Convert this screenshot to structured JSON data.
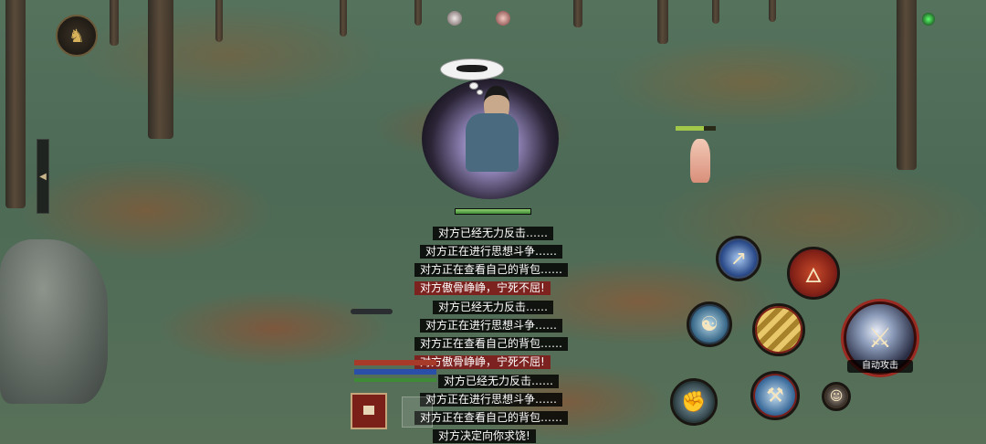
{
  "colors": {
    "log_bg": "#000000",
    "log_highlight_bg": "#821818",
    "hp_green": "#3f8a36",
    "skill_ring": "#9b2a22"
  },
  "icons": {
    "avatar": "warrior-portrait-icon",
    "thought_bubble": "thought-bubble-icon",
    "auto_attack": "sword-slash-icon"
  },
  "status": {
    "player_hp_fraction": 1.0,
    "npc_hp_fraction": 0.7
  },
  "combat_log": [
    {
      "text": "对方已经无力反击……",
      "highlight": false
    },
    {
      "text": "对方正在进行思想斗争……",
      "highlight": false
    },
    {
      "text": "对方正在查看自己的背包……",
      "highlight": false
    },
    {
      "text": "对方傲骨峥峥，宁死不屈!",
      "highlight": true
    },
    {
      "text": "对方已经无力反击……",
      "highlight": false
    },
    {
      "text": "对方正在进行思想斗争……",
      "highlight": false
    },
    {
      "text": "对方正在查看自己的背包……",
      "highlight": false
    },
    {
      "text": "对方傲骨峥峥，宁死不屈!",
      "highlight": true
    },
    {
      "text": "对方已经无力反击……",
      "highlight": false
    },
    {
      "text": "对方正在进行思想斗争……",
      "highlight": false
    },
    {
      "text": "对方正在查看自己的背包……",
      "highlight": false
    },
    {
      "text": "对方决定向你求饶!",
      "highlight": false
    }
  ],
  "skills": {
    "auto_attack_label": "自动攻击"
  }
}
